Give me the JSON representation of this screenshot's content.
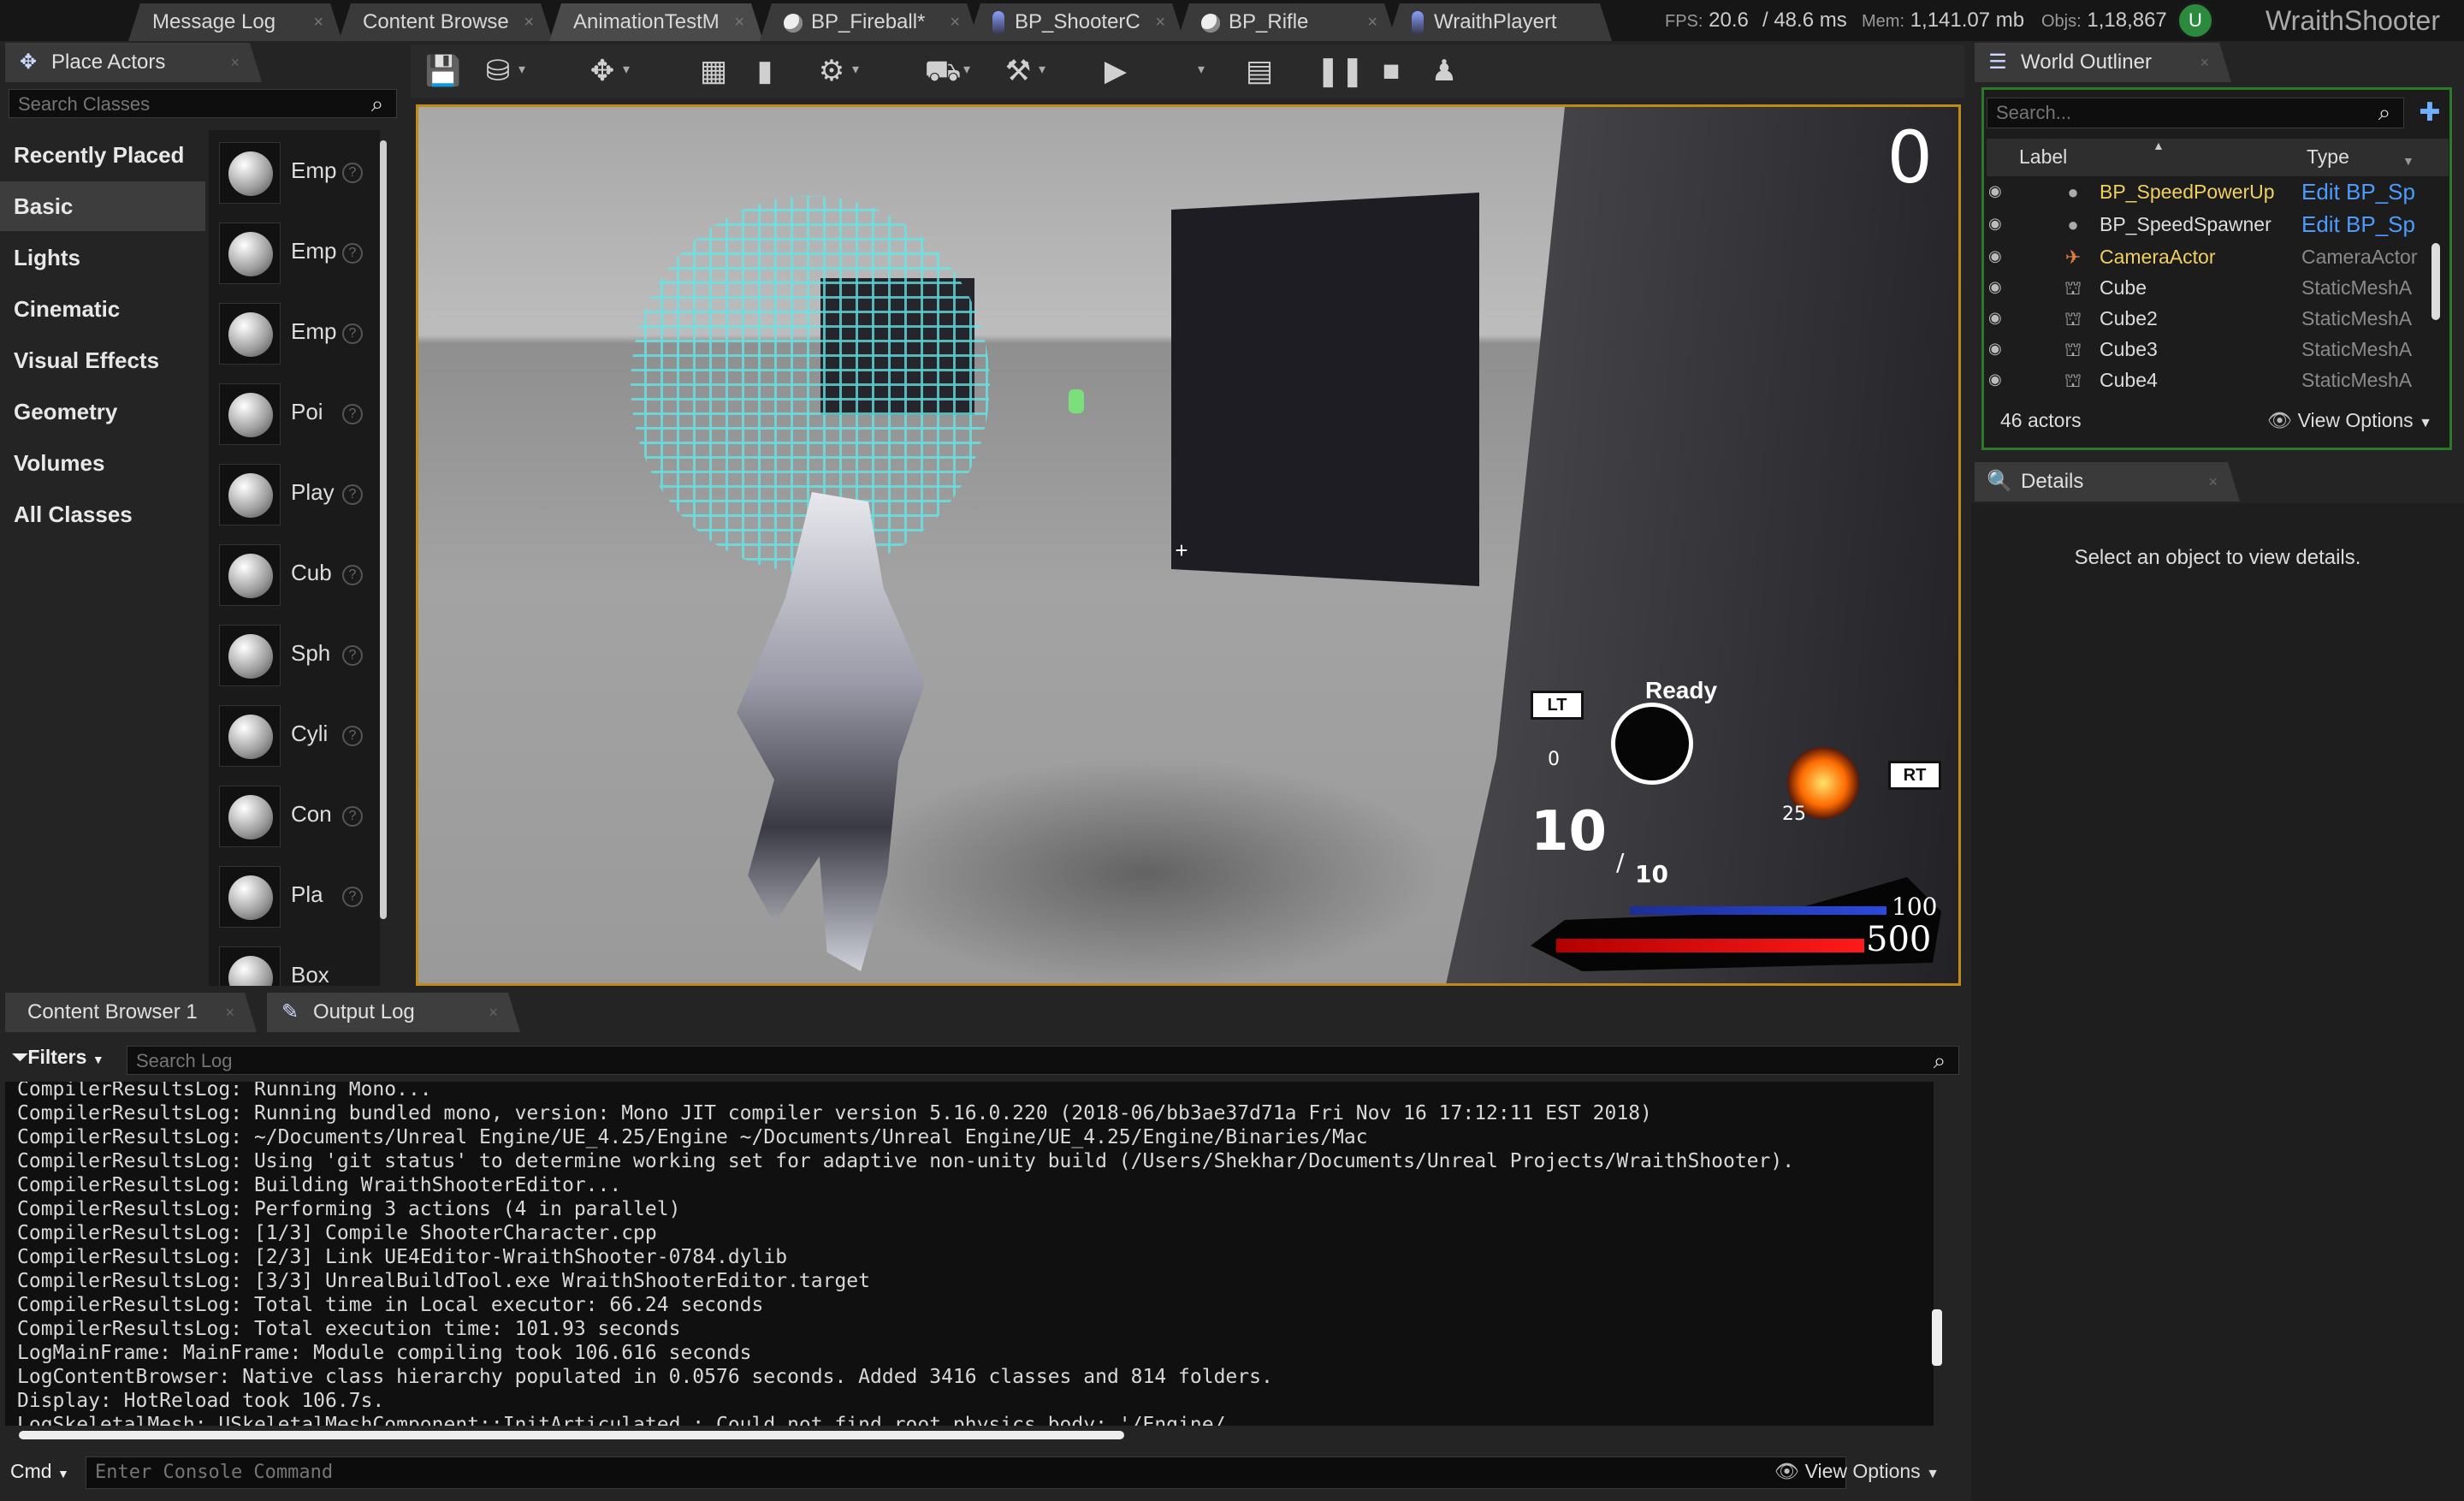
{
  "top_tabs": [
    {
      "label": "Message Log"
    },
    {
      "label": "Content Browse"
    },
    {
      "label": "AnimationTestM"
    },
    {
      "label": "BP_Fireball*"
    },
    {
      "label": "BP_ShooterC"
    },
    {
      "label": "BP_Rifle"
    },
    {
      "label": "WraithPlayert"
    }
  ],
  "stats": {
    "fps_label": "FPS:",
    "fps": "20.6",
    "ms": "/ 48.6 ms",
    "mem_label": "Mem:",
    "mem": "1,141.07 mb",
    "objs_label": "Objs:",
    "objs": "1,18,867"
  },
  "project_title": "WraithShooter",
  "place_actors": {
    "tab_label": "Place Actors",
    "search_placeholder": "Search Classes",
    "categories": [
      "Recently Placed",
      "Basic",
      "Lights",
      "Cinematic",
      "Visual Effects",
      "Geometry",
      "Volumes",
      "All Classes"
    ],
    "active_category": "Basic",
    "items": [
      "Emp",
      "Emp",
      "Emp",
      "Poi",
      "Play",
      "Cub",
      "Sph",
      "Cyli",
      "Con",
      "Pla",
      "Box"
    ]
  },
  "toolbar": {
    "icons": [
      "save-icon",
      "source-control-icon",
      "modes-icon",
      "content-icon",
      "blueprints-icon",
      "cinematics-icon",
      "build-icon",
      "compile-icon",
      "play-icon",
      "launch-icon",
      "pause-icon",
      "stop-icon",
      "possess-icon"
    ]
  },
  "viewport": {
    "score": "0",
    "crosshair": "+",
    "hud": {
      "lt_key": "LT",
      "rt_key": "RT",
      "ready": "Ready",
      "lt_count": "0",
      "rt_count": "25",
      "ammo": "10",
      "ammo_max": "10",
      "mana": "100",
      "health": "500"
    }
  },
  "world_outliner": {
    "tab_label": "World Outliner",
    "search_placeholder": "Search...",
    "col_label": "Label",
    "col_type": "Type",
    "rows": [
      {
        "label": "BP_SpeedPowerUp",
        "type": "Edit BP_Sp",
        "type_link": true,
        "highlight": true
      },
      {
        "label": "BP_SpeedSpawner",
        "type": "Edit BP_Sp",
        "type_link": true,
        "highlight": false
      },
      {
        "label": "CameraActor",
        "type": "CameraActor",
        "type_link": false,
        "highlight": true
      },
      {
        "label": "Cube",
        "type": "StaticMeshA",
        "type_link": false,
        "highlight": false
      },
      {
        "label": "Cube2",
        "type": "StaticMeshA",
        "type_link": false,
        "highlight": false
      },
      {
        "label": "Cube3",
        "type": "StaticMeshA",
        "type_link": false,
        "highlight": false
      },
      {
        "label": "Cube4",
        "type": "StaticMeshA",
        "type_link": false,
        "highlight": false
      }
    ],
    "actor_count": "46 actors",
    "view_options": "View Options"
  },
  "details": {
    "tab_label": "Details",
    "empty_message": "Select an object to view details."
  },
  "bottom_tabs": {
    "content_browser": "Content Browser 1",
    "output_log": "Output Log"
  },
  "output_log": {
    "filters_label": "Filters",
    "search_placeholder": "Search Log",
    "lines": [
      "CompilerResultsLog: Running Mono...",
      "CompilerResultsLog: Running bundled mono, version: Mono JIT compiler version 5.16.0.220 (2018-06/bb3ae37d71a Fri Nov 16 17:12:11 EST 2018)",
      "CompilerResultsLog: ~/Documents/Unreal Engine/UE_4.25/Engine ~/Documents/Unreal Engine/UE_4.25/Engine/Binaries/Mac",
      "CompilerResultsLog: Using 'git status' to determine working set for adaptive non-unity build (/Users/Shekhar/Documents/Unreal Projects/WraithShooter).",
      "CompilerResultsLog: Building WraithShooterEditor...",
      "CompilerResultsLog: Performing 3 actions (4 in parallel)",
      "CompilerResultsLog: [1/3] Compile ShooterCharacter.cpp",
      "CompilerResultsLog: [2/3] Link UE4Editor-WraithShooter-0784.dylib",
      "CompilerResultsLog: [3/3] UnrealBuildTool.exe WraithShooterEditor.target",
      "CompilerResultsLog: Total time in Local executor: 66.24 seconds",
      "CompilerResultsLog: Total execution time: 101.93 seconds",
      "LogMainFrame: MainFrame: Module compiling took 106.616 seconds",
      "LogContentBrowser: Native class hierarchy populated in 0.0576 seconds. Added 3416 classes and 814 folders.",
      "Display: HotReload took 106.7s.",
      "LogSkeletalMesh: USkeletalMeshComponent::InitArticulated : Could not find root physics body: '/Engine/"
    ]
  },
  "console": {
    "cmd_label": "Cmd",
    "placeholder": "Enter Console Command",
    "view_options": "View Options"
  },
  "colors": {
    "accent_viewport_border": "#c08a18",
    "link_blue": "#4d9bff",
    "highlight_yellow": "#f0d060",
    "hud_blue": "#2b4adb",
    "hud_red": "#ff1a1a",
    "wireframe_cyan": "#64e6e6"
  }
}
